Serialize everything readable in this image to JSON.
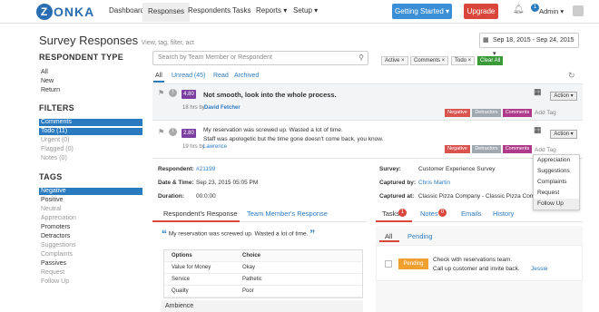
{
  "nav": {
    "logo_rest": "ONKA",
    "logo_letter": "Z",
    "items": [
      "Dashboard",
      "Responses",
      "Respondents",
      "Tasks",
      "Reports ▾",
      "Setup ▾"
    ],
    "getting_started": "Getting Started ▾",
    "upgrade": "Upgrade",
    "admin": "Admin ▾",
    "notif_count": "1"
  },
  "page": {
    "title": "Survey Responses",
    "subtitle": "View, tag, filter, act",
    "date_range": "Sep 18, 2015 - Sep 24, 2015 ▾"
  },
  "sidebar": {
    "respondent_type": {
      "title": "RESPONDENT TYPE",
      "items": [
        "All",
        "New",
        "Return"
      ]
    },
    "filters": {
      "title": "FILTERS",
      "items": [
        "Comments",
        "Todo (11)",
        "Urgent (0)",
        "Flagged (0)",
        "Notes (0)"
      ]
    },
    "tags": {
      "title": "TAGS",
      "items": [
        "Negative",
        "Positive",
        "Neutral",
        "Appreciation",
        "Promoters",
        "Detractors",
        "Suggestions",
        "Complaints",
        "Passives",
        "Request",
        "Follow Up"
      ]
    }
  },
  "search": {
    "placeholder": "Search by Team Member or Respondent"
  },
  "chips": [
    "Active ×",
    "Comments ×",
    "Todo ×"
  ],
  "clear_all": "Clear All",
  "tabs": [
    "All",
    "Unread (45)",
    "Read",
    "Archived"
  ],
  "responses": [
    {
      "score": "4.80",
      "title": "Not smooth, look into the whole process.",
      "meta": "18 hrs by",
      "author": "David Fetcher",
      "tags": [
        "Negative",
        "Detractors",
        "Comments"
      ],
      "color": "#7b3fa0"
    },
    {
      "score": "2.80",
      "title": "My reservation was screwed up. Wasted a lot of time.",
      "title2": "Staff was apologetic but the time gone doesn't come back, you know.",
      "meta": "19 hrs by",
      "author": "Lawrence",
      "tags": [
        "Negative",
        "Detractors",
        "Comments"
      ],
      "color": "#7b3fa0"
    }
  ],
  "action_label": "Action ▾",
  "add_tag": "Add Tag",
  "dropdown": [
    "Appreciation",
    "Suggestions",
    "Complaints",
    "Request",
    "Follow Up"
  ],
  "detail": {
    "respondent_label": "Respondent:",
    "respondent": "#21199",
    "datetime_label": "Date & Time:",
    "datetime": "Sep 23, 2015 05:05 PM",
    "duration_label": "Duration:",
    "duration": "00:0:00",
    "survey_label": "Survey:",
    "survey": "Customer Experience Survey",
    "captured_by_label": "Captured by:",
    "captured_by": "Chris Martin",
    "captured_at_label": "Captured at:",
    "captured_at": "Classic Pizza Company - Classic Pizza Company"
  },
  "resp_tabs": [
    "Respondent's Response",
    "Team Member's Response"
  ],
  "quote": "My reservation was screwed up. Wasted a lot of time.",
  "table": {
    "headers": [
      "Options",
      "Choice"
    ],
    "rows": [
      [
        "Value for Money",
        "Okay"
      ],
      [
        "Service",
        "Pathetic"
      ],
      [
        "Quality",
        "Poor"
      ]
    ],
    "section": "Ambience"
  },
  "task_tabs": [
    {
      "label": "Tasks",
      "count": "1"
    },
    {
      "label": "Notes",
      "count": "0"
    },
    {
      "label": "Emails"
    },
    {
      "label": "History"
    }
  ],
  "task_subtabs": [
    "All",
    "Pending"
  ],
  "task": {
    "status": "Pending",
    "line1": "Check with reservations team.",
    "line2": "Call up customer and invite back.",
    "assignee": "Jessie"
  }
}
